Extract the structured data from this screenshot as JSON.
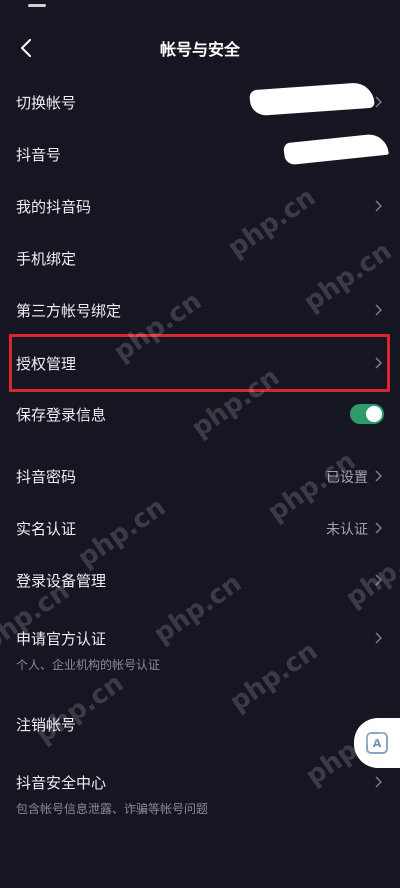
{
  "header": {
    "title": "帐号与安全"
  },
  "rows": [
    {
      "label": "切换帐号",
      "value": "",
      "sub": ""
    },
    {
      "label": "抖音号",
      "value": "",
      "sub": ""
    },
    {
      "label": "我的抖音码",
      "value": "",
      "sub": ""
    },
    {
      "label": "手机绑定",
      "value": "",
      "sub": ""
    },
    {
      "label": "第三方帐号绑定",
      "value": "",
      "sub": ""
    },
    {
      "label": "授权管理",
      "value": "",
      "sub": ""
    },
    {
      "label": "保存登录信息",
      "value": "",
      "sub": "",
      "toggle_on": true
    },
    {
      "label": "抖音密码",
      "value": "已设置",
      "sub": ""
    },
    {
      "label": "实名认证",
      "value": "未认证",
      "sub": ""
    },
    {
      "label": "登录设备管理",
      "value": "",
      "sub": ""
    },
    {
      "label": "申请官方认证",
      "value": "",
      "sub": "个人、企业机构的帐号认证"
    },
    {
      "label": "注销帐号",
      "value": "",
      "sub": ""
    },
    {
      "label": "抖音安全中心",
      "value": "",
      "sub": "包含帐号信息泄露、诈骗等帐号问题"
    }
  ],
  "watermark": {
    "text": "php.cn"
  },
  "float_button": {
    "icon": "text-recognition-icon",
    "glyph": "A"
  },
  "colors": {
    "background": "#161622",
    "highlight": "#d8262d",
    "toggle_on": "#2e9c6a"
  }
}
